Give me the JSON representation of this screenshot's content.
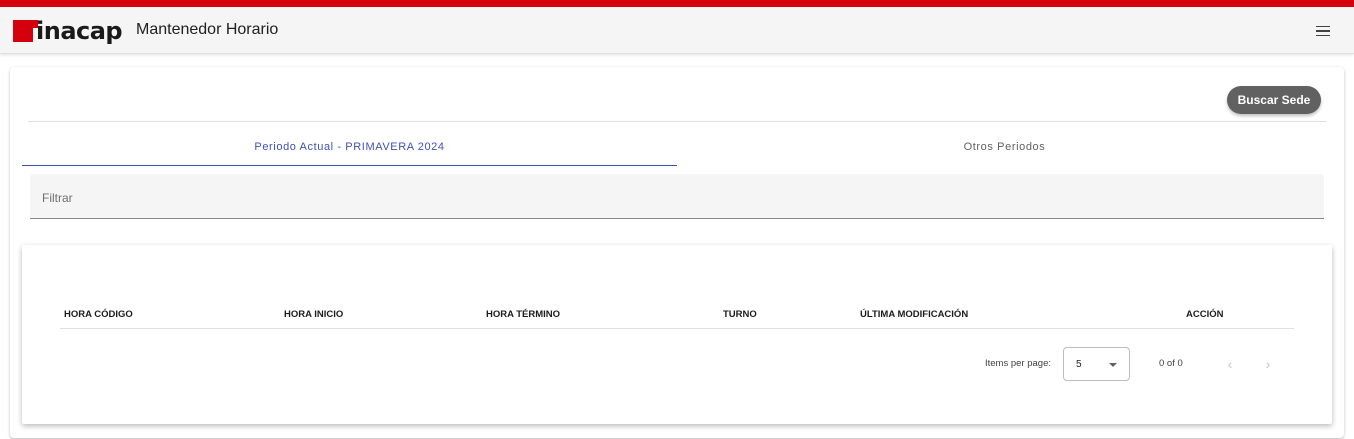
{
  "header": {
    "logo_text": "inacap",
    "app_title": "Mantenedor Horario",
    "menu_icon": "hamburger-menu-icon"
  },
  "colors": {
    "brand_red": "#d5000d",
    "tab_active": "#3f51b5",
    "button_bg": "#616161"
  },
  "toolbar": {
    "buscar_sede_label": "Buscar Sede"
  },
  "tabs": [
    {
      "label": "Periodo Actual - PRIMAVERA 2024",
      "active": true
    },
    {
      "label": "Otros Periodos",
      "active": false
    }
  ],
  "filter": {
    "placeholder": "Filtrar",
    "value": ""
  },
  "table": {
    "columns": [
      "HORA CÓDIGO",
      "HORA INICIO",
      "HORA TÉRMINO",
      "TURNO",
      "ÚLTIMA MODIFICACIÓN",
      "ACCIÓN"
    ],
    "rows": []
  },
  "paginator": {
    "items_per_page_label": "Items per page:",
    "page_size": "5",
    "range_label": "0 of 0",
    "prev_icon": "chevron-left-icon",
    "next_icon": "chevron-right-icon"
  }
}
